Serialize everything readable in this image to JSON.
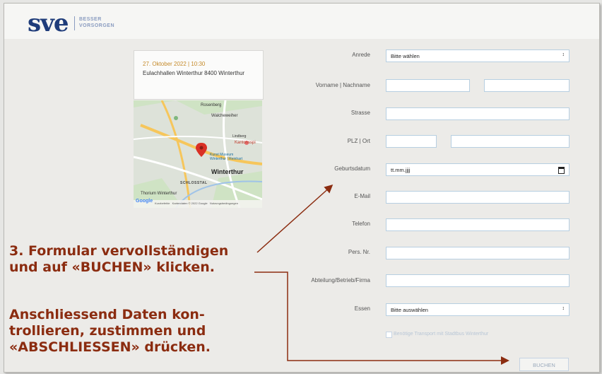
{
  "header": {
    "logo_text": "sve",
    "tagline_line1": "BESSER",
    "tagline_line2": "VORSORGEN"
  },
  "event": {
    "date_time": "27. Oktober 2022 | 10:30",
    "location": "Eulachhallen Winterthur 8400 Winterthur"
  },
  "map": {
    "labels": [
      "Rosenberg",
      "Walcheweiher",
      "Kantonsspi",
      "Kunst Museum Winterthur | Reinhart",
      "Winterthur",
      "SCHLOSSTAL",
      "Thorium Winterthur",
      "Google",
      "Lindberg"
    ],
    "footer": "Kurzbefehle   Kartendaten © 2022 Google   Nutzungsbedingungen"
  },
  "form": {
    "anrede_label": "Anrede",
    "anrede_value": "Bitte wählen",
    "name_label": "Vorname | Nachname",
    "strasse_label": "Strasse",
    "plz_label": "PLZ | Ort",
    "geburtsdatum_label": "Geburtsdatum",
    "geburtsdatum_placeholder": "tt.mm.jjjj",
    "email_label": "E-Mail",
    "telefon_label": "Telefon",
    "persnr_label": "Pers. Nr.",
    "abteilung_label": "Abteilung/Betrieb/Firma",
    "essen_label": "Essen",
    "essen_value": "Bitte auswählen",
    "transport_label": "Benötige Transport mit Stadtbus Winterthur",
    "submit_label": "BUCHEN"
  },
  "annotation": {
    "step_line1": "3. Formular vervollständigen",
    "step_line2": "und auf «BUCHEN» klicken.",
    "note_line1": "Anschliessend Daten kon-",
    "note_line2": "trollieren, zustimmen und",
    "note_line3": "«ABSCHLIESSEN» drücken."
  },
  "colors": {
    "logo": "#1f3c7a",
    "annotation": "#8b2c10",
    "field_border": "#b7cfe1",
    "map_pin": "#d93025"
  }
}
